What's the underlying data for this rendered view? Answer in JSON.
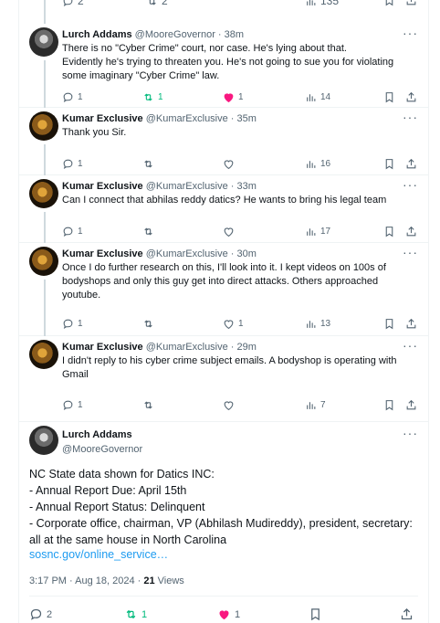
{
  "top_actions": {
    "replies": "2",
    "reposts": "2",
    "views": "135"
  },
  "replies": [
    {
      "name": "Lurch Addams",
      "handle": "@MooreGovernor",
      "time": "38m",
      "text": "There is no \"Cyber Crime\" court, nor case.  He's lying about that.\nEvidently he's trying to threaten you.  He's not going to sue you for violating\nsome imaginary \"Cyber Crime\" law.",
      "reply_count": "1",
      "repost_count": "1",
      "like_count": "1",
      "view_count": "14"
    },
    {
      "name": "Kumar Exclusive",
      "handle": "@KumarExclusive",
      "time": "35m",
      "text": "Thank you Sir.",
      "reply_count": "1",
      "repost_count": "",
      "like_count": "",
      "view_count": "16"
    },
    {
      "name": "Kumar Exclusive",
      "handle": "@KumarExclusive",
      "time": "33m",
      "text": "Can I connect that abhilas reddy datics? He wants to bring his legal team",
      "reply_count": "1",
      "repost_count": "",
      "like_count": "",
      "view_count": "17"
    },
    {
      "name": "Kumar Exclusive",
      "handle": "@KumarExclusive",
      "time": "30m",
      "text": "Once I do further research on this, I'll look into it. I kept videos on 100s of\nbodyshops and only this guy get into direct attacks. Others approached\nyoutube.",
      "reply_count": "1",
      "repost_count": "",
      "like_count": "1",
      "view_count": "13"
    },
    {
      "name": "Kumar Exclusive",
      "handle": "@KumarExclusive",
      "time": "29m",
      "text": "I didn't reply to his cyber crime subject emails. A bodyshop is operating with\nGmail",
      "reply_count": "1",
      "repost_count": "",
      "like_count": "",
      "view_count": "7"
    }
  ],
  "main_post": {
    "name": "Lurch Addams",
    "handle": "@MooreGovernor",
    "body": "NC State data shown for Datics INC:\n- Annual Report Due: April 15th\n- Annual Report Status: Delinquent\n- Corporate office, chairman, VP (Abhilash Mudireddy), president, secretary:\nall at the same house in North Carolina",
    "link": "sosnc.gov/online_service…",
    "timestamp": "3:17 PM · Aug 18, 2024 · ",
    "views_count": "21",
    "views_label": " Views",
    "reply_count": "2",
    "repost_count": "1",
    "like_count": "1"
  },
  "colors": {
    "accent": "#1d9bf0",
    "repost": "#00ba7c",
    "like": "#f91880",
    "muted": "#536471"
  },
  "icons": [
    "reply-icon",
    "repost-icon",
    "like-icon",
    "views-icon",
    "bookmark-icon",
    "share-icon",
    "more-icon"
  ]
}
